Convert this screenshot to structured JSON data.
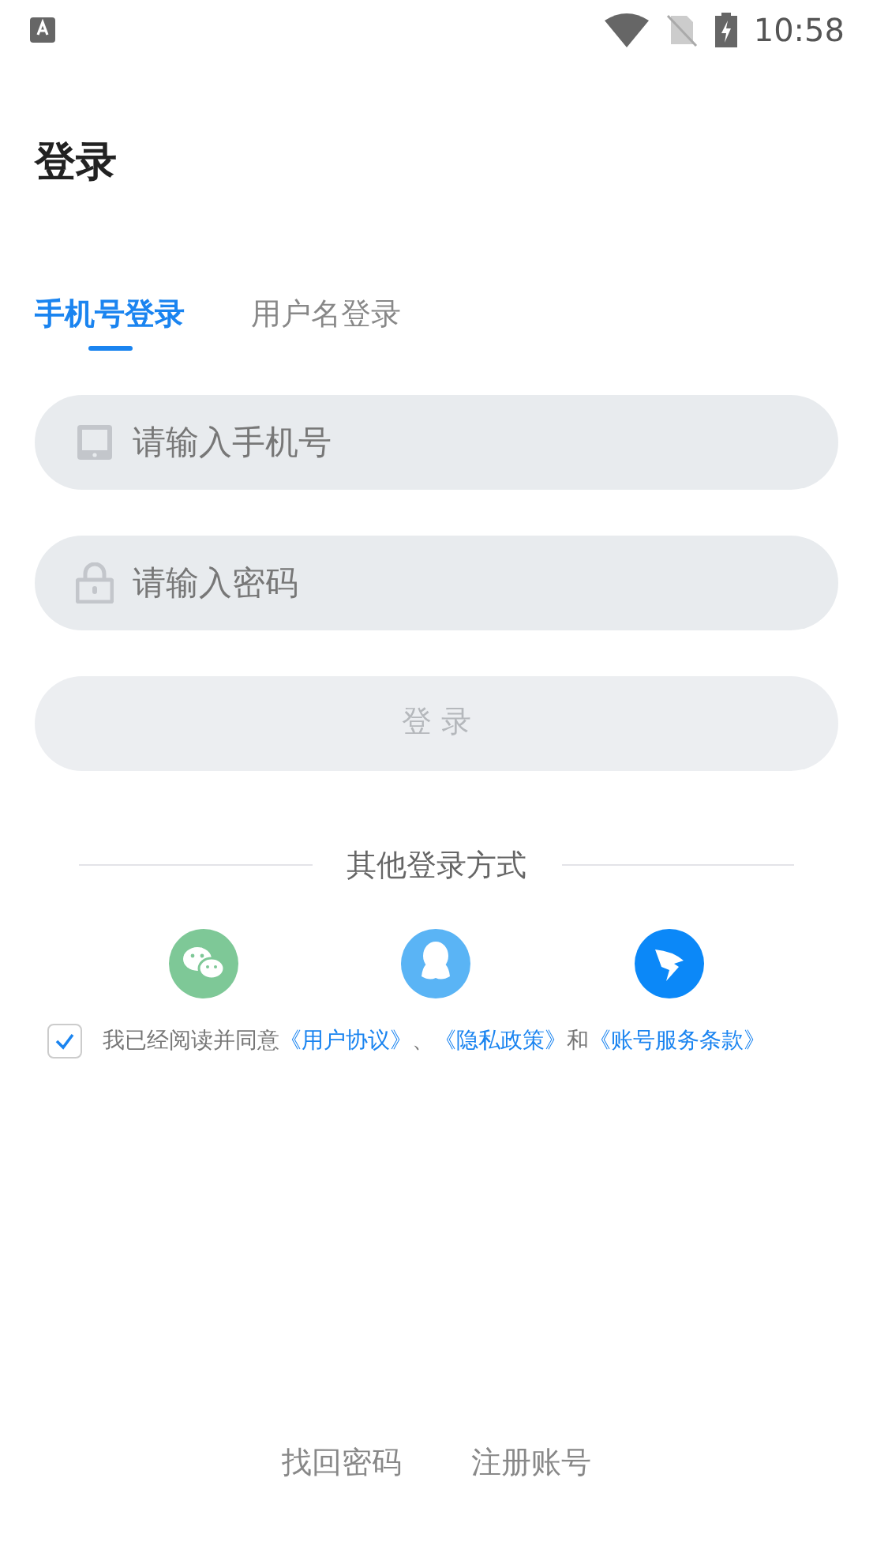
{
  "status_bar": {
    "time": "10:58"
  },
  "title": "登录",
  "tabs": [
    {
      "label": "手机号登录",
      "selected": true
    },
    {
      "label": "用户名登录",
      "selected": false
    }
  ],
  "fields": [
    {
      "kind": "phone",
      "placeholder": "请输入手机号"
    },
    {
      "kind": "password",
      "placeholder": "请输入密码"
    }
  ],
  "login_button": {
    "label": "登 录",
    "disabled": true
  },
  "other_login": {
    "label": "其他登录方式",
    "providers": [
      {
        "kind": "chat"
      },
      {
        "kind": "penguin"
      },
      {
        "kind": "wing"
      }
    ]
  },
  "agreement": {
    "checked": true,
    "parts": [
      {
        "kind": "text",
        "text": "我已经阅读并同意"
      },
      {
        "kind": "link",
        "text": "《用户协议》"
      },
      {
        "kind": "text",
        "text": "、"
      },
      {
        "kind": "link",
        "text": "《隐私政策》"
      },
      {
        "kind": "text",
        "text": "和"
      },
      {
        "kind": "link",
        "text": "《账号服务条款》"
      }
    ]
  },
  "footer_links": [
    "找回密码",
    "注册账号"
  ]
}
